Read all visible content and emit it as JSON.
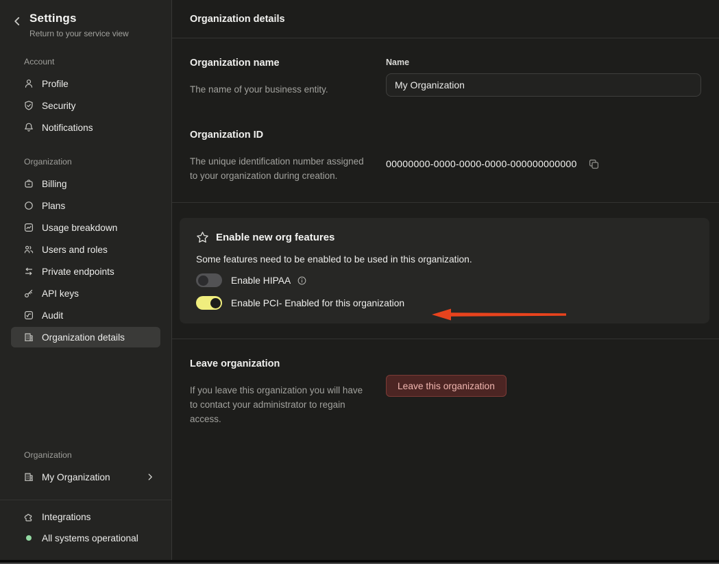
{
  "sidebar": {
    "title": "Settings",
    "subtitle": "Return to your service view",
    "account_label": "Account",
    "account_items": [
      {
        "icon": "user-icon",
        "label": "Profile"
      },
      {
        "icon": "shield-check-icon",
        "label": "Security"
      },
      {
        "icon": "bell-icon",
        "label": "Notifications"
      }
    ],
    "org_label": "Organization",
    "org_items": [
      {
        "icon": "billing-icon",
        "label": "Billing"
      },
      {
        "icon": "circle-icon",
        "label": "Plans"
      },
      {
        "icon": "chart-square-icon",
        "label": "Usage breakdown"
      },
      {
        "icon": "users-icon",
        "label": "Users and roles"
      },
      {
        "icon": "swap-arrows-icon",
        "label": "Private endpoints"
      },
      {
        "icon": "key-icon",
        "label": "API keys"
      },
      {
        "icon": "audit-check-square-icon",
        "label": "Audit"
      },
      {
        "icon": "building-icon",
        "label": "Organization details",
        "selected": true
      }
    ],
    "switcher": {
      "section_label": "Organization",
      "value": "My Organization"
    },
    "footer": {
      "integrations_label": "Integrations",
      "status_label": "All systems operational"
    }
  },
  "main": {
    "header_title": "Organization details",
    "org_name": {
      "heading": "Organization name",
      "description": "The name of your business entity.",
      "field_label": "Name",
      "field_value": "My Organization"
    },
    "org_id": {
      "heading": "Organization ID",
      "description": "The unique identification number assigned to your organization during creation.",
      "value": "00000000-0000-0000-0000-000000000000"
    },
    "features": {
      "title": "Enable new org features",
      "description": "Some features need to be enabled to be used in this organization.",
      "hipaa_label": "Enable HIPAA",
      "hipaa_enabled": false,
      "pci_label": "Enable PCI- Enabled for this organization",
      "pci_enabled": true
    },
    "leave": {
      "heading": "Leave organization",
      "description": "If you leave this organization you will have to contact your administrator to regain access.",
      "button_label": "Leave this organization"
    }
  },
  "colors": {
    "toggle_on_yellow": "#f0ee7e",
    "status_green": "#93d9a2",
    "annotation_arrow_red": "#e8431d",
    "danger_button_bg": "#4c2523",
    "danger_button_text": "#f1b6b0"
  }
}
